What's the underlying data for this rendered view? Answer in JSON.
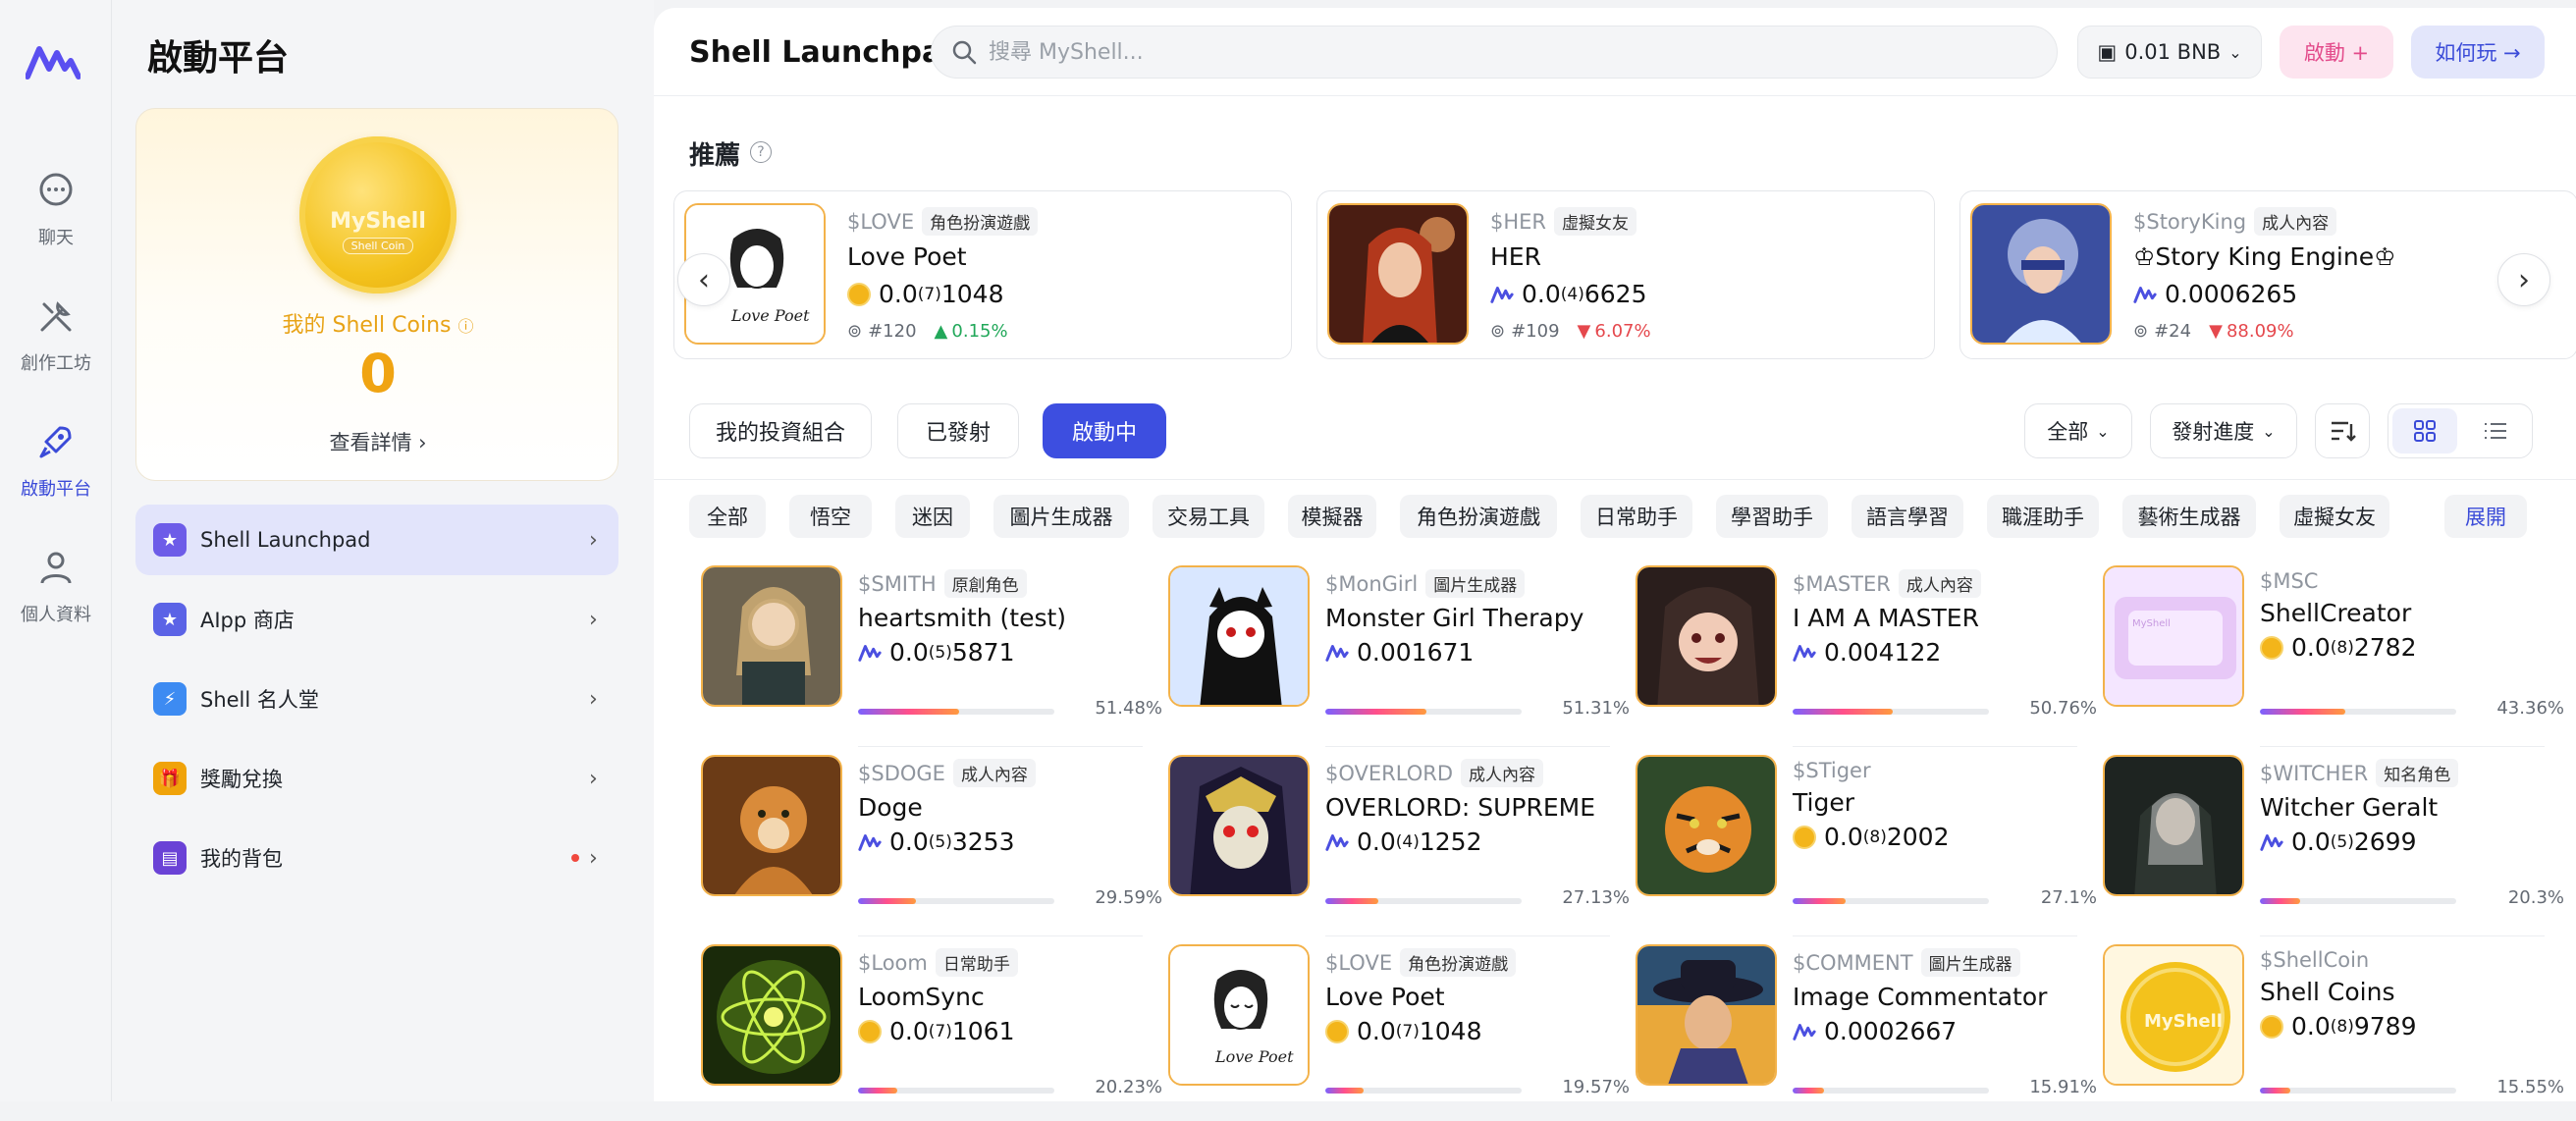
{
  "rail": {
    "items": [
      {
        "label": "聊天",
        "icon": "chat-bubble-icon"
      },
      {
        "label": "創作工坊",
        "icon": "tools-icon"
      },
      {
        "label": "啟動平台",
        "icon": "rocket-icon"
      },
      {
        "label": "個人資料",
        "icon": "user-icon"
      }
    ]
  },
  "panel": {
    "title": "啟動平台",
    "coin_card": {
      "logo_word": "MyShell",
      "logo_sub": "Shell Coin",
      "label": "我的 Shell Coins",
      "value": "0",
      "details_link": "查看詳情 ›"
    },
    "nav": [
      {
        "label": "Shell Launchpad",
        "icon": "star-icon",
        "color": "#6d5ce8",
        "active": true
      },
      {
        "label": "AIpp 商店",
        "icon": "star-icon",
        "color": "#5b63e6",
        "active": false
      },
      {
        "label": "Shell 名人堂",
        "icon": "lightning-icon",
        "color": "#3d8bf2",
        "active": false
      },
      {
        "label": "獎勵兌換",
        "icon": "gift-icon",
        "color": "#f0a30a",
        "active": false
      },
      {
        "label": "我的背包",
        "icon": "bag-icon",
        "color": "#6a42d6",
        "active": false,
        "dot": true
      }
    ]
  },
  "header": {
    "title": "Shell Launchpad",
    "search_placeholder": "搜尋 MyShell...",
    "wallet": "0.01 BNB",
    "launch": "啟動 +",
    "howto": "如何玩 →"
  },
  "recommend": {
    "title": "推薦",
    "help": "?",
    "cards": [
      {
        "ticker": "$LOVE",
        "tag": "角色扮演遊戲",
        "name": "Love Poet",
        "price_a": "0.0",
        "price_sub": "(7)",
        "price_b": "1048",
        "coin": "shell-coin",
        "rank": "#120",
        "change": "0.15%",
        "dir": "up"
      },
      {
        "ticker": "$HER",
        "tag": "虛擬女友",
        "name": "HER",
        "price_a": "0.0",
        "price_sub": "(4)",
        "price_b": "6625",
        "coin": "myshell",
        "rank": "#109",
        "change": "6.07%",
        "dir": "down"
      },
      {
        "ticker": "$StoryKing",
        "tag": "成人內容",
        "name": "♔Story King Engine♔",
        "price_a": "0.0006265",
        "price_sub": "",
        "price_b": "",
        "coin": "myshell",
        "rank": "#24",
        "change": "88.09%",
        "dir": "down"
      }
    ]
  },
  "tabs": {
    "portfolio": "我的投資組合",
    "launched": "已發射",
    "launching": "啟動中"
  },
  "filters": {
    "all": "全部",
    "progress": "發射進度"
  },
  "categories": [
    "全部",
    "悟空",
    "迷因",
    "圖片生成器",
    "交易工具",
    "模擬器",
    "角色扮演遊戲",
    "日常助手",
    "學習助手",
    "語言學習",
    "職涯助手",
    "藝術生成器",
    "虛擬女友"
  ],
  "expand": "展開",
  "grid": [
    {
      "ticker": "$SMITH",
      "tag": "原創角色",
      "name": "heartsmith (test)",
      "price_a": "0.0",
      "price_sub": "(5)",
      "price_b": "5871",
      "coin": "myshell",
      "progress": 0.5148,
      "pct": "51.48%",
      "art": "a1"
    },
    {
      "ticker": "$MonGirl",
      "tag": "圖片生成器",
      "name": "Monster Girl Therapy",
      "price_a": "0.001671",
      "price_sub": "",
      "price_b": "",
      "coin": "myshell",
      "progress": 0.5131,
      "pct": "51.31%",
      "art": "a2"
    },
    {
      "ticker": "$MASTER",
      "tag": "成人內容",
      "name": "I AM A MASTER",
      "price_a": "0.004122",
      "price_sub": "",
      "price_b": "",
      "coin": "myshell",
      "progress": 0.5076,
      "pct": "50.76%",
      "art": "a3"
    },
    {
      "ticker": "$MSC",
      "tag": "",
      "name": "ShellCreator",
      "price_a": "0.0",
      "price_sub": "(8)",
      "price_b": "2782",
      "coin": "shell-coin",
      "progress": 0.4336,
      "pct": "43.36%",
      "art": "a4"
    },
    {
      "ticker": "$SDOGE",
      "tag": "成人內容",
      "name": "Doge",
      "price_a": "0.0",
      "price_sub": "(5)",
      "price_b": "3253",
      "coin": "myshell",
      "progress": 0.2959,
      "pct": "29.59%",
      "art": "a5"
    },
    {
      "ticker": "$OVERLORD",
      "tag": "成人內容",
      "name": "OVERLORD: SUPREME",
      "price_a": "0.0",
      "price_sub": "(4)",
      "price_b": "1252",
      "coin": "myshell",
      "progress": 0.2713,
      "pct": "27.13%",
      "art": "a6"
    },
    {
      "ticker": "$STiger",
      "tag": "",
      "name": "Tiger",
      "price_a": "0.0",
      "price_sub": "(8)",
      "price_b": "2002",
      "coin": "shell-coin",
      "progress": 0.271,
      "pct": "27.1%",
      "art": "a7"
    },
    {
      "ticker": "$WITCHER",
      "tag": "知名角色",
      "name": "Witcher Geralt",
      "price_a": "0.0",
      "price_sub": "(5)",
      "price_b": "2699",
      "coin": "myshell",
      "progress": 0.203,
      "pct": "20.3%",
      "art": "a8"
    },
    {
      "ticker": "$Loom",
      "tag": "日常助手",
      "name": "LoomSync",
      "price_a": "0.0",
      "price_sub": "(7)",
      "price_b": "1061",
      "coin": "shell-coin",
      "progress": 0.2023,
      "pct": "20.23%",
      "art": "a9"
    },
    {
      "ticker": "$LOVE",
      "tag": "角色扮演遊戲",
      "name": "Love Poet",
      "price_a": "0.0",
      "price_sub": "(7)",
      "price_b": "1048",
      "coin": "shell-coin",
      "progress": 0.1957,
      "pct": "19.57%",
      "art": "a10"
    },
    {
      "ticker": "$COMMENT",
      "tag": "圖片生成器",
      "name": "Image Commentator",
      "price_a": "0.0002667",
      "price_sub": "",
      "price_b": "",
      "coin": "myshell",
      "progress": 0.1591,
      "pct": "15.91%",
      "art": "a11"
    },
    {
      "ticker": "$ShellCoin",
      "tag": "",
      "name": "Shell Coins",
      "price_a": "0.0",
      "price_sub": "(8)",
      "price_b": "9789",
      "coin": "shell-coin",
      "progress": 0.1555,
      "pct": "15.55%",
      "art": "a12"
    }
  ]
}
